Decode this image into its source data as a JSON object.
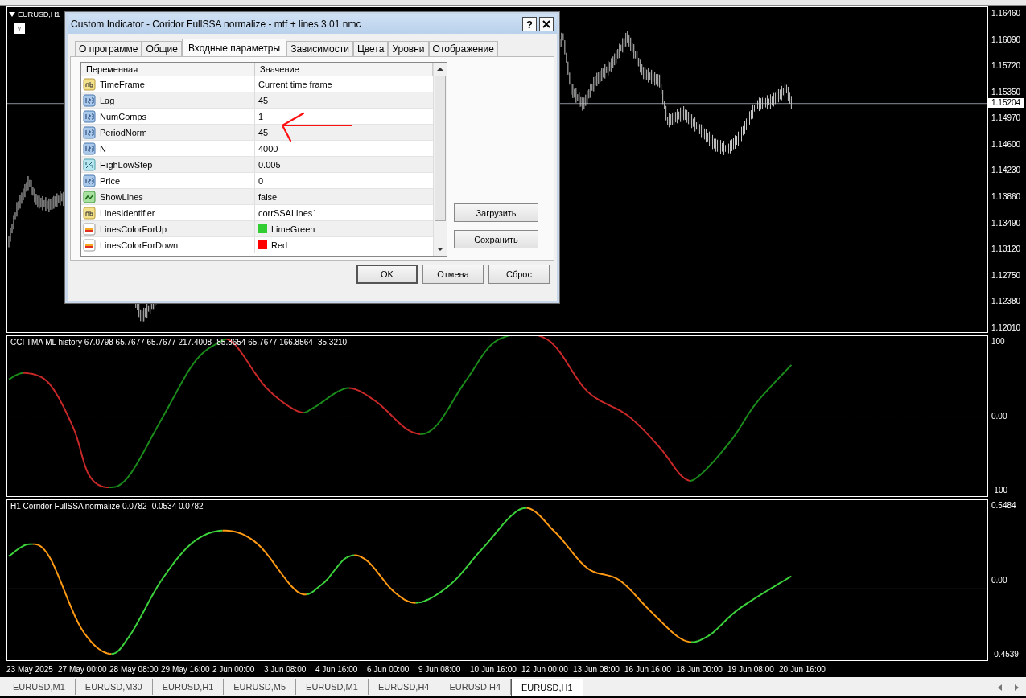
{
  "chart": {
    "symbol_label": "EURUSD,H1",
    "one_click_label": "v",
    "current_price": "1.15204",
    "price_axis": [
      "1.16460",
      "1.16090",
      "1.15720",
      "1.15350",
      "1.14970",
      "1.14600",
      "1.14230",
      "1.13860",
      "1.13490",
      "1.13120",
      "1.12750",
      "1.12380",
      "1.12010"
    ]
  },
  "indicator_1": {
    "label": "CCI TMA ML history 67.0798 65.7677 65.7677 217.4008 -85.8654 65.7677 166.8564 -35.3210",
    "axis": [
      "100",
      "0.00",
      "-100"
    ]
  },
  "indicator_2": {
    "label": "H1 Corridor FullSSA normalize 0.0782 -0.0534 0.0782",
    "axis": [
      "0.5484",
      "0.00",
      "-0.4539"
    ]
  },
  "time_axis": [
    "23 May 2025",
    "27 May 00:00",
    "28 May 08:00",
    "29 May 16:00",
    "2 Jun 00:00",
    "3 Jun 08:00",
    "4 Jun 16:00",
    "6 Jun 00:00",
    "9 Jun 08:00",
    "10 Jun 16:00",
    "12 Jun 00:00",
    "13 Jun 08:00",
    "16 Jun 16:00",
    "18 Jun 00:00",
    "19 Jun 08:00",
    "20 Jun 16:00"
  ],
  "chart_tabs": [
    {
      "label": "EURUSD,M1",
      "selected": false
    },
    {
      "label": "EURUSD,M30",
      "selected": false
    },
    {
      "label": "EURUSD,H1",
      "selected": false
    },
    {
      "label": "EURUSD,M5",
      "selected": false
    },
    {
      "label": "EURUSD,M1",
      "selected": false
    },
    {
      "label": "EURUSD,H4",
      "selected": false
    },
    {
      "label": "EURUSD,H4",
      "selected": false
    },
    {
      "label": "EURUSD,H1",
      "selected": true
    }
  ],
  "dialog": {
    "title": "Custom Indicator - Coridor FullSSA normalize - mtf + lines 3.01 nmc",
    "help_button": "?",
    "tabs": [
      {
        "label": "О программе",
        "selected": false
      },
      {
        "label": "Общие",
        "selected": false
      },
      {
        "label": "Входные параметры",
        "selected": true
      },
      {
        "label": "Зависимости",
        "selected": false
      },
      {
        "label": "Цвета",
        "selected": false
      },
      {
        "label": "Уровни",
        "selected": false
      },
      {
        "label": "Отображение",
        "selected": false
      }
    ],
    "columns": [
      "Переменная",
      "Значение"
    ],
    "rows": [
      {
        "kind": "string",
        "variable": "TimeFrame",
        "value": "Current time frame"
      },
      {
        "kind": "int",
        "variable": "Lag",
        "value": "45"
      },
      {
        "kind": "int",
        "variable": "NumComps",
        "value": "1"
      },
      {
        "kind": "int",
        "variable": "PeriodNorm",
        "value": "45"
      },
      {
        "kind": "int",
        "variable": "N",
        "value": "4000"
      },
      {
        "kind": "double",
        "variable": "HighLowStep",
        "value": "0.005"
      },
      {
        "kind": "int",
        "variable": "Price",
        "value": "0"
      },
      {
        "kind": "bool",
        "variable": "ShowLines",
        "value": "false"
      },
      {
        "kind": "string",
        "variable": "LinesIdentifier",
        "value": "corrSSALines1"
      },
      {
        "kind": "color",
        "variable": "LinesColorForUp",
        "value": "LimeGreen",
        "color": "#32cd32"
      },
      {
        "kind": "color",
        "variable": "LinesColorForDown",
        "value": "Red",
        "color": "#ff0000"
      }
    ],
    "side_buttons": [
      "Загрузить",
      "Сохранить"
    ],
    "buttons": [
      "OK",
      "Отмена",
      "Сброс"
    ]
  }
}
